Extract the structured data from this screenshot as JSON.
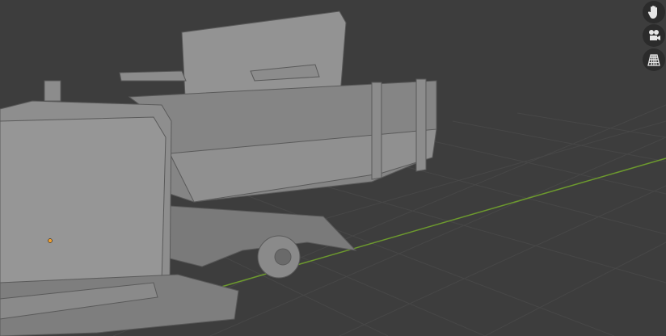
{
  "viewport": {
    "background_color": "#3d3d3d",
    "grid_color": "#4a4a4a",
    "x_axis_color": "#6d9a2e",
    "model_color": "#8a8a8a",
    "origin_color": "#f0a030"
  },
  "navigation_gizmo": [
    {
      "icon": "hand-pan-icon"
    },
    {
      "icon": "camera-icon"
    },
    {
      "icon": "perspective-grid-icon"
    }
  ]
}
